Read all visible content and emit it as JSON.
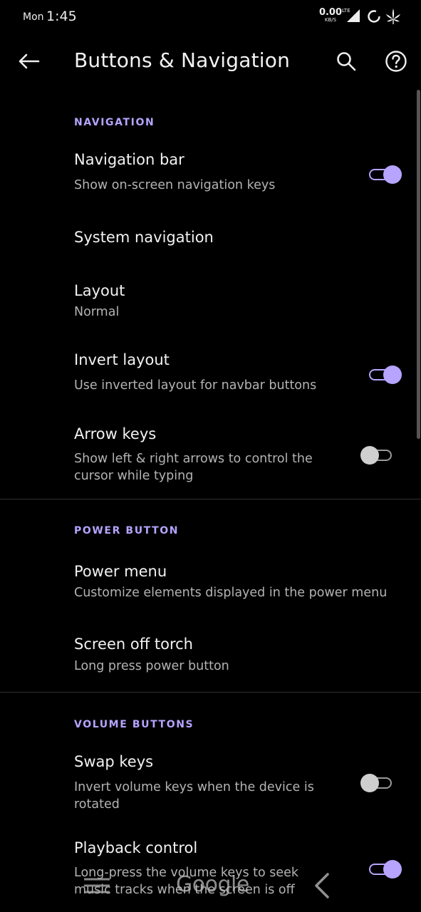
{
  "status": {
    "day": "Mon",
    "time": "1:45",
    "speed_value": "0.00",
    "speed_unit": "KB/S",
    "network": "LTE"
  },
  "appbar": {
    "title": "Buttons & Navigation"
  },
  "sections": {
    "navigation": "NAVIGATION",
    "power": "POWER BUTTON",
    "volume": "VOLUME BUTTONS"
  },
  "items": {
    "navigation_bar": {
      "title": "Navigation bar",
      "sub": "Show on-screen navigation keys",
      "on": true
    },
    "system_navigation": {
      "title": "System navigation"
    },
    "layout": {
      "title": "Layout",
      "sub": "Normal"
    },
    "invert_layout": {
      "title": "Invert layout",
      "sub": "Use inverted layout for navbar buttons",
      "on": true
    },
    "arrow_keys": {
      "title": "Arrow keys",
      "sub": "Show left & right arrows to control the cursor while typing",
      "on": false
    },
    "power_menu": {
      "title": "Power menu",
      "sub": "Customize elements displayed in the power menu"
    },
    "screen_off_torch": {
      "title": "Screen off torch",
      "sub": "Long press power button"
    },
    "swap_keys": {
      "title": "Swap keys",
      "sub": "Invert volume keys when the device is rotated",
      "on": false
    },
    "playback_control": {
      "title": "Playback control",
      "sub": "Long-press the volume keys to seek music tracks when the screen is off",
      "on": true
    }
  },
  "navbar": {
    "center_label": "Google"
  },
  "colors": {
    "accent": "#b6a4ff",
    "background": "#000000"
  }
}
